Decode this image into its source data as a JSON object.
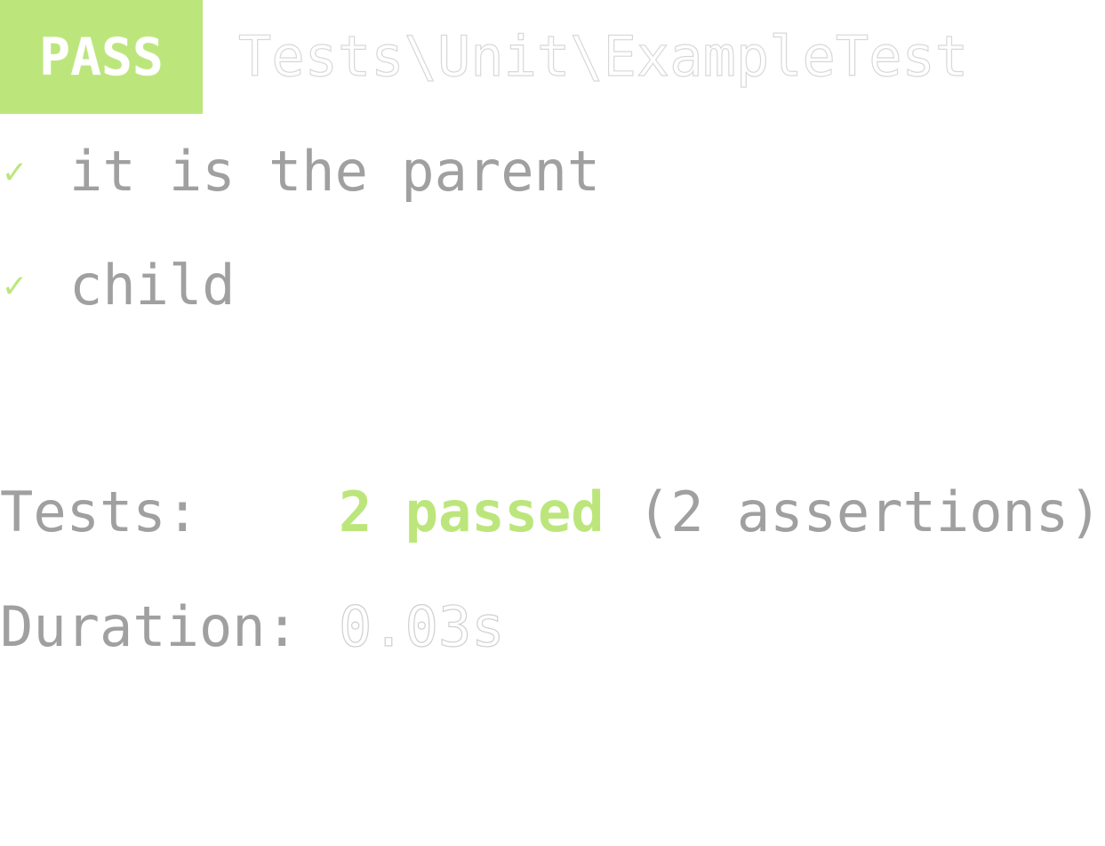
{
  "header": {
    "status_label": "PASS",
    "suite_name": "Tests\\Unit\\ExampleTest"
  },
  "tests": [
    {
      "icon": "✓",
      "name": "it is the parent"
    },
    {
      "icon": "✓",
      "name": "child"
    }
  ],
  "summary": {
    "tests_label": "Tests:",
    "passed_text": "2 passed",
    "assertions_text": "(2 assertions)",
    "duration_label": "Duration:",
    "duration_value": "0.03s"
  },
  "colors": {
    "pass": "#bce67c",
    "text": "#a0a0a0",
    "background": "#ffffff"
  }
}
